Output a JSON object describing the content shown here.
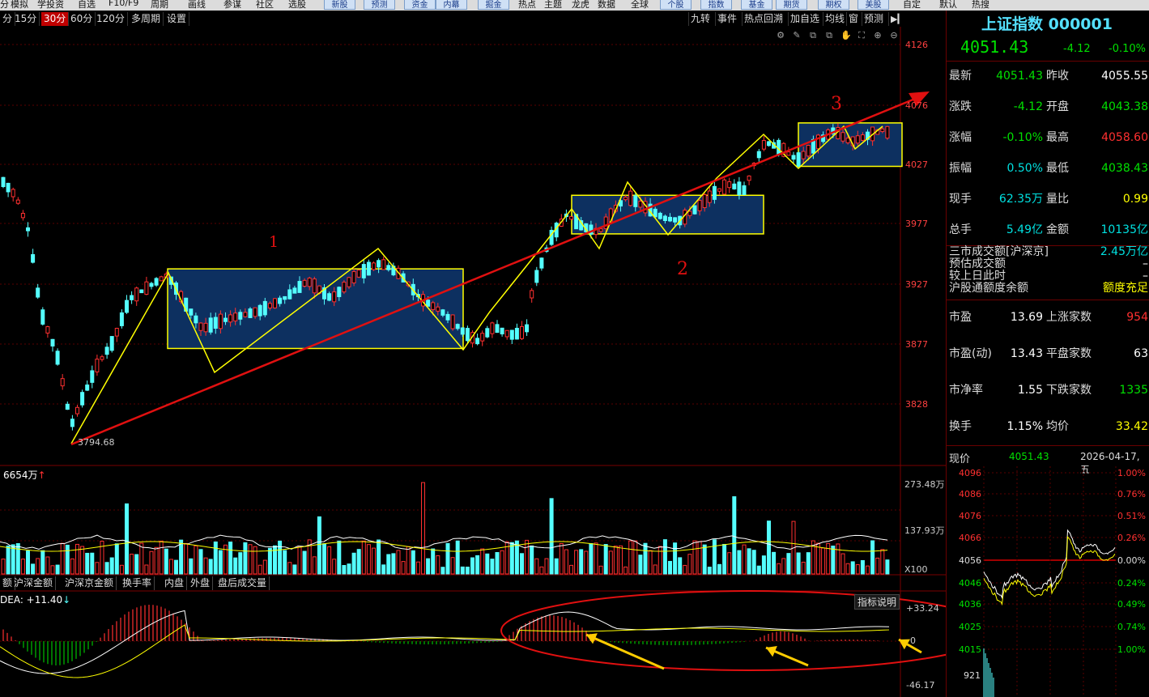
{
  "topmenu": [
    {
      "label": "分",
      "btn": false
    },
    {
      "label": "模拟",
      "btn": false
    },
    {
      "label": "学投资",
      "btn": false
    },
    {
      "label": "自选",
      "btn": false
    },
    {
      "label": "F10/F9",
      "btn": false
    },
    {
      "label": "周期",
      "btn": false
    },
    {
      "label": "画线",
      "btn": false
    },
    {
      "label": "参谋",
      "btn": false
    },
    {
      "label": "社区",
      "btn": false
    },
    {
      "label": "选股",
      "btn": false
    },
    {
      "label": "新股",
      "btn": true
    },
    {
      "label": "预测",
      "btn": true
    },
    {
      "label": "资金",
      "btn": true
    },
    {
      "label": "内幕",
      "btn": true
    },
    {
      "label": "掘金",
      "btn": true
    },
    {
      "label": "热点",
      "btn": false
    },
    {
      "label": "主题",
      "btn": false
    },
    {
      "label": "龙虎",
      "btn": false
    },
    {
      "label": "数据",
      "btn": false
    },
    {
      "label": "全球",
      "btn": false
    },
    {
      "label": "个股",
      "btn": true
    },
    {
      "label": "指数",
      "btn": true
    },
    {
      "label": "基金",
      "btn": true
    },
    {
      "label": "期货",
      "btn": true
    },
    {
      "label": "期权",
      "btn": true
    },
    {
      "label": "美股",
      "btn": true
    },
    {
      "label": "自定",
      "btn": false
    },
    {
      "label": "默认",
      "btn": false
    },
    {
      "label": "热搜",
      "btn": false
    }
  ],
  "periods": [
    "分",
    "15分",
    "30分",
    "60分",
    "120分",
    "多周期",
    "设置"
  ],
  "active_period": "30分",
  "right_toolbar": [
    "九转",
    "事件",
    "热点回溯",
    "加自选",
    "均线",
    "窗",
    "预测"
  ],
  "chart_toolbar_icons": [
    "gear-icon",
    "pen-icon",
    "copy-icon",
    "copy2-icon",
    "hand-icon",
    "fullscreen-icon",
    "plus-icon",
    "minus-icon"
  ],
  "price_axis": [
    "4126",
    "4076",
    "4027",
    "3977",
    "3927",
    "3877",
    "3828"
  ],
  "low_label": "3794.68",
  "annotations": [
    "1",
    "2",
    "3"
  ],
  "volume": {
    "header": "6654万",
    "axis_top": "273.48万",
    "axis_mid": "137.93万",
    "unit": "X100"
  },
  "indicator_tabs": [
    "额",
    "沪深金额",
    "沪深京金额",
    "换手率",
    "内盘",
    "外盘",
    "盘后成交量"
  ],
  "macd": {
    "header": "DEA: +11.40",
    "help": "指标说明",
    "axis_top": "+33.24",
    "axis_zero": "0",
    "axis_bottom": "-46.17"
  },
  "quote": {
    "name": "上证指数",
    "code": "000001",
    "price": "4051.43",
    "change": "-4.12",
    "pct": "-0.10%",
    "rows": [
      {
        "l1": "最新",
        "v1": "4051.43",
        "c1": "g",
        "l2": "昨收",
        "v2": "4055.55",
        "c2": "w"
      },
      {
        "l1": "涨跌",
        "v1": "-4.12",
        "c1": "g",
        "l2": "开盘",
        "v2": "4043.38",
        "c2": "g"
      },
      {
        "l1": "涨幅",
        "v1": "-0.10%",
        "c1": "g",
        "l2": "最高",
        "v2": "4058.60",
        "c2": "r"
      },
      {
        "l1": "振幅",
        "v1": "0.50%",
        "c1": "c",
        "l2": "最低",
        "v2": "4038.43",
        "c2": "g"
      },
      {
        "l1": "现手",
        "v1": "62.35万",
        "c1": "c",
        "l2": "量比",
        "v2": "0.99",
        "c2": "y"
      },
      {
        "l1": "总手",
        "v1": "5.49亿",
        "c1": "c",
        "l2": "金额",
        "v2": "10135亿",
        "c2": "c"
      }
    ],
    "market": [
      {
        "label": "三市成交额[沪深京]",
        "value": "2.45万亿",
        "vc": "c"
      },
      {
        "label": "预估成交额",
        "value": "–",
        "vc": "w"
      },
      {
        "label": "较上日此时",
        "value": "–",
        "vc": "w"
      },
      {
        "label": "沪股通额度余额",
        "value": "额度充足",
        "vc": "y"
      }
    ],
    "valuation": [
      {
        "l1": "市盈",
        "v1": "13.69",
        "l2": "上涨家数",
        "v2": "954",
        "c2": "r"
      },
      {
        "l1": "市盈(动)",
        "v1": "13.43",
        "l2": "平盘家数",
        "v2": "63",
        "c2": "w"
      },
      {
        "l1": "市净率",
        "v1": "1.55",
        "l2": "下跌家数",
        "v2": "1335",
        "c2": "g"
      },
      {
        "l1": "换手",
        "v1": "1.15%",
        "l2": "均价",
        "v2": "33.42",
        "c2": "y"
      }
    ]
  },
  "intraday": {
    "label": "现价",
    "price": "4051.43",
    "datetime": "2026-04-17,五",
    "left_axis": [
      "4096",
      "4086",
      "4076",
      "4066",
      "4056",
      "4046",
      "4036",
      "4025",
      "4015"
    ],
    "right_axis": [
      "1.00%",
      "0.76%",
      "0.51%",
      "0.26%",
      "0.00%",
      "0.24%",
      "0.49%",
      "0.74%",
      "1.00%"
    ],
    "vol_label": "921"
  },
  "colors": {
    "up": "#ff3030",
    "down": "#54ffff",
    "bg": "#000000",
    "grid": "#5a0000",
    "box_fill": "#0d3060",
    "box_edge": "#ffff00",
    "trend": "#e01010"
  }
}
